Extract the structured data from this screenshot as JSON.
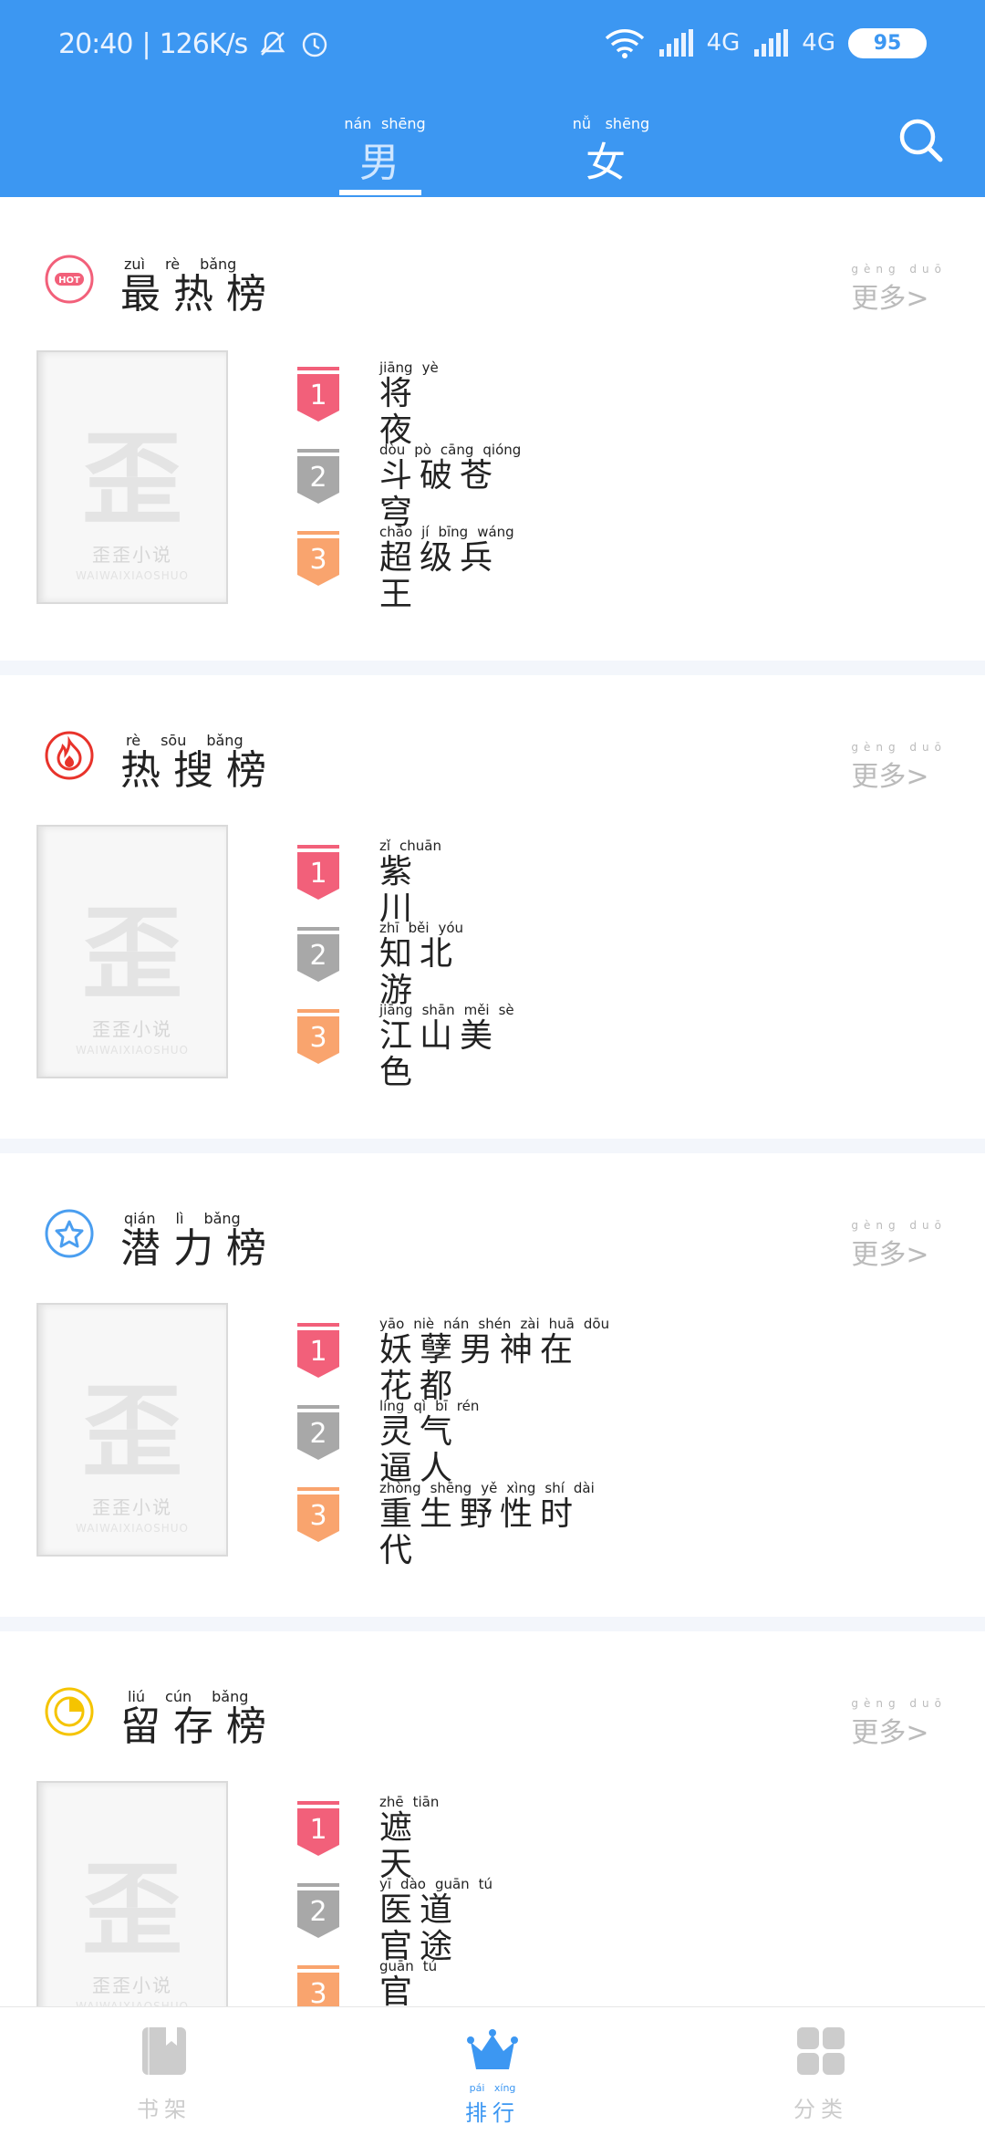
{
  "status_bar": {
    "time": "20:40",
    "net_speed": "126K/s",
    "network_1": "4G",
    "network_2": "4G",
    "battery": "95"
  },
  "gender_tabs": [
    {
      "pinyin": [
        "nán",
        "shēng"
      ],
      "label": "男生",
      "selected": true
    },
    {
      "pinyin": [
        "nǚ",
        "shēng"
      ],
      "label": "女生",
      "selected": false
    }
  ],
  "sections": [
    {
      "icon": "hot-icon",
      "pinyin": [
        "zuì",
        "rè",
        "bǎng"
      ],
      "title": "最热榜",
      "more_pinyin": [
        "gèng",
        "duō"
      ],
      "more": "更多>",
      "cover_caption": "歪歪小说",
      "cover_sub": "WAIWAIXIAOSHUO",
      "items": [
        {
          "rank": "1",
          "pinyin": [
            "jiāng",
            "yè"
          ],
          "title": "将夜"
        },
        {
          "rank": "2",
          "pinyin": [
            "dòu",
            "pò",
            "cāng",
            "qióng"
          ],
          "title": "斗破苍穹"
        },
        {
          "rank": "3",
          "pinyin": [
            "chāo",
            "jí",
            "bīng",
            "wáng"
          ],
          "title": "超级兵王"
        }
      ]
    },
    {
      "icon": "flame-icon",
      "pinyin": [
        "rè",
        "sōu",
        "bǎng"
      ],
      "title": "热搜榜",
      "more_pinyin": [
        "gèng",
        "duō"
      ],
      "more": "更多>",
      "cover_caption": "歪歪小说",
      "cover_sub": "WAIWAIXIAOSHUO",
      "items": [
        {
          "rank": "1",
          "pinyin": [
            "zǐ",
            "chuān"
          ],
          "title": "紫川"
        },
        {
          "rank": "2",
          "pinyin": [
            "zhī",
            "běi",
            "yóu"
          ],
          "title": "知北游"
        },
        {
          "rank": "3",
          "pinyin": [
            "jiāng",
            "shān",
            "měi",
            "sè"
          ],
          "title": "江山美色"
        }
      ]
    },
    {
      "icon": "star-badge-icon",
      "pinyin": [
        "qián",
        "lì",
        "bǎng"
      ],
      "title": "潜力榜",
      "more_pinyin": [
        "gèng",
        "duō"
      ],
      "more": "更多>",
      "cover_caption": "歪歪小说",
      "cover_sub": "WAIWAIXIAOSHUO",
      "items": [
        {
          "rank": "1",
          "pinyin": [
            "yāo",
            "niè",
            "nán",
            "shén",
            "zài",
            "huā",
            "dōu"
          ],
          "title": "妖孽男神在花都"
        },
        {
          "rank": "2",
          "pinyin": [
            "líng",
            "qì",
            "bī",
            "rén"
          ],
          "title": "灵气逼人"
        },
        {
          "rank": "3",
          "pinyin": [
            "zhòng",
            "shēng",
            "yě",
            "xìng",
            "shí",
            "dài"
          ],
          "title": "重生野性时代"
        }
      ]
    },
    {
      "icon": "pie-chart-icon",
      "pinyin": [
        "liú",
        "cún",
        "bǎng"
      ],
      "title": "留存榜",
      "more_pinyin": [
        "gèng",
        "duō"
      ],
      "more": "更多>",
      "cover_caption": "歪歪小说",
      "cover_sub": "WAIWAIXIAOSHUO",
      "items": [
        {
          "rank": "1",
          "pinyin": [
            "zhē",
            "tiān"
          ],
          "title": "遮天"
        },
        {
          "rank": "2",
          "pinyin": [
            "yī",
            "dào",
            "guān",
            "tú"
          ],
          "title": "医道官途"
        },
        {
          "rank": "3",
          "pinyin": [
            "guān",
            "tú"
          ],
          "title": "官途"
        }
      ]
    }
  ],
  "bottom_nav": [
    {
      "icon": "bookshelf-icon",
      "pinyin": [
        "",
        ""
      ],
      "label": "书架",
      "active": false
    },
    {
      "icon": "crown-icon",
      "pinyin": [
        "pái",
        "xíng"
      ],
      "label": "排行",
      "active": true
    },
    {
      "icon": "grid-icon",
      "pinyin": [
        "",
        ""
      ],
      "label": "分类",
      "active": false
    }
  ],
  "colors": {
    "header": "#3c97f2",
    "rank_1": "#f2607a",
    "rank_2": "#a8a8a8",
    "rank_3": "#f9a46e",
    "active_nav": "#3c97f2",
    "inactive_nav": "#cccccc"
  }
}
